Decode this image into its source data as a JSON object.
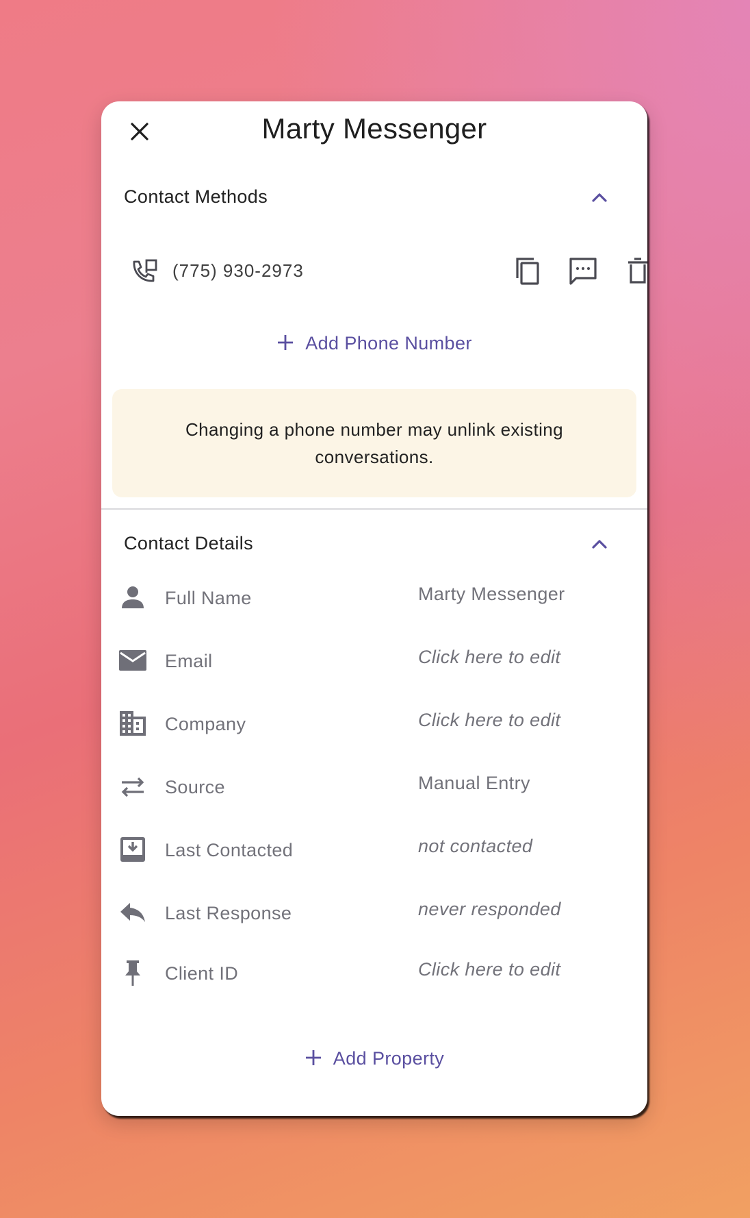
{
  "modal": {
    "title": "Marty Messenger"
  },
  "contact_methods": {
    "section_title": "Contact Methods",
    "phone": "(775) 930-2973",
    "add_phone_label": "Add Phone Number",
    "warning": "Changing a phone number may unlink existing conversations."
  },
  "contact_details": {
    "section_title": "Contact Details",
    "rows": [
      {
        "label": "Full Name",
        "value": "Marty Messenger",
        "icon": "person-icon"
      },
      {
        "label": "Email",
        "value": "Click here to edit",
        "icon": "email-icon"
      },
      {
        "label": "Company",
        "value": "Click here to edit",
        "icon": "company-icon"
      },
      {
        "label": "Source",
        "value": "Manual Entry",
        "icon": "swap-arrows-icon"
      },
      {
        "label": "Last Contacted",
        "value": "not contacted",
        "icon": "inbox-download-icon"
      },
      {
        "label": "Last Response",
        "value": "never responded",
        "icon": "reply-icon"
      },
      {
        "label": "Client ID",
        "value": "Click here to edit",
        "icon": "pin-icon"
      }
    ],
    "add_property_label": "Add Property"
  },
  "colors": {
    "accent": "#5a4fa0",
    "icon_gray": "#6f6f78",
    "warning_bg": "#fcf5e6"
  }
}
